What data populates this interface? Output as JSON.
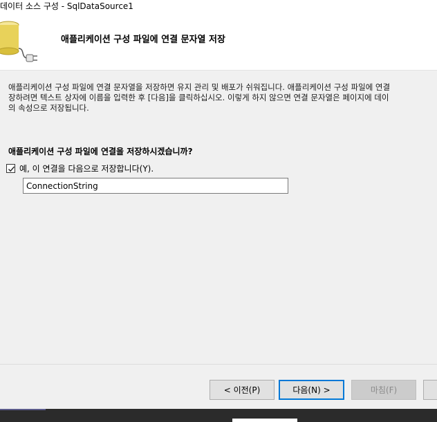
{
  "window": {
    "title": "데이터 소스 구성 - SqlDataSource1"
  },
  "header": {
    "title": "애플리케이션 구성 파일에 연결 문자열 저장",
    "icon": "database-plug-icon"
  },
  "description": {
    "line1": "애플리케이션 구성 파일에 연결 문자열을 저장하면 유지 관리 및 배포가 쉬워집니다. 애플리케이션 구성 파일에 연결",
    "line2": "장하려면 텍스트 상자에 이름을 입력한 후 [다음]을 클릭하십시오. 이렇게 하지 않으면 연결 문자열은 페이지에 데이",
    "line3": "의 속성으로 저장됩니다."
  },
  "question": "애플리케이션 구성 파일에 연결을 저장하시겠습니까?",
  "save_checkbox": {
    "label": "예, 이 연결을 다음으로 저장합니다(Y).",
    "checked": true
  },
  "connection_name": {
    "value": "ConnectionString"
  },
  "buttons": {
    "prev": "< 이전(P)",
    "next": "다음(N) >",
    "finish": "마침(F)"
  },
  "colors": {
    "accent": "#0078d7",
    "dialog_bg": "#f0f0f0"
  }
}
